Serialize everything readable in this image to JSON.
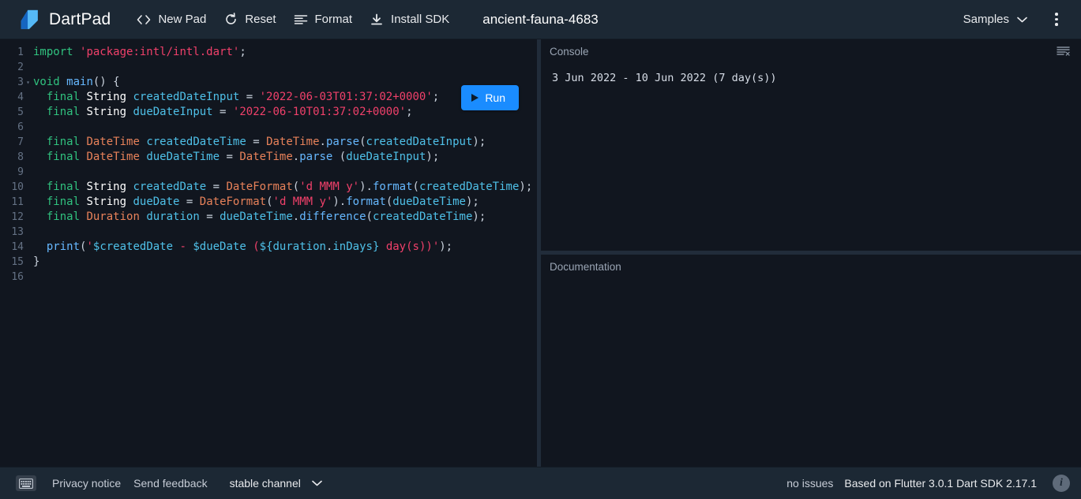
{
  "header": {
    "brand": "DartPad",
    "logo_icon": "dart-logo-icon",
    "actions": [
      {
        "label": "New Pad",
        "icon": "code-brackets-icon"
      },
      {
        "label": "Reset",
        "icon": "refresh-icon"
      },
      {
        "label": "Format",
        "icon": "format-lines-icon"
      },
      {
        "label": "Install SDK",
        "icon": "download-icon"
      }
    ],
    "document_title": "ancient-fauna-4683",
    "samples_label": "Samples",
    "samples_chevron_icon": "chevron-down-icon",
    "overflow_menu_icon": "kebab-menu-icon"
  },
  "editor": {
    "run_button": {
      "label": "Run",
      "icon": "play-icon"
    },
    "lines": [
      {
        "n": "1",
        "fold": "",
        "tokens": [
          {
            "t": "import",
            "c": "kw"
          },
          {
            "t": " ",
            "c": "punct"
          },
          {
            "t": "'package:intl/intl.dart'",
            "c": "str"
          },
          {
            "t": ";",
            "c": "punct"
          }
        ]
      },
      {
        "n": "2",
        "fold": "",
        "tokens": []
      },
      {
        "n": "3",
        "fold": "▾",
        "tokens": [
          {
            "t": "void",
            "c": "kw"
          },
          {
            "t": " ",
            "c": "punct"
          },
          {
            "t": "main",
            "c": "kw2"
          },
          {
            "t": "() {",
            "c": "punct"
          }
        ]
      },
      {
        "n": "4",
        "fold": "",
        "tokens": [
          {
            "t": "  ",
            "c": "punct"
          },
          {
            "t": "final",
            "c": "kw"
          },
          {
            "t": " ",
            "c": "punct"
          },
          {
            "t": "String",
            "c": "type"
          },
          {
            "t": " ",
            "c": "punct"
          },
          {
            "t": "createdDateInput",
            "c": "var"
          },
          {
            "t": " = ",
            "c": "punct"
          },
          {
            "t": "'2022-06-03T01:37:02+0000'",
            "c": "str"
          },
          {
            "t": ";",
            "c": "punct"
          }
        ]
      },
      {
        "n": "5",
        "fold": "",
        "tokens": [
          {
            "t": "  ",
            "c": "punct"
          },
          {
            "t": "final",
            "c": "kw"
          },
          {
            "t": " ",
            "c": "punct"
          },
          {
            "t": "String",
            "c": "type"
          },
          {
            "t": " ",
            "c": "punct"
          },
          {
            "t": "dueDateInput",
            "c": "var"
          },
          {
            "t": " = ",
            "c": "punct"
          },
          {
            "t": "'2022-06-10T01:37:02+0000'",
            "c": "str"
          },
          {
            "t": ";",
            "c": "punct"
          }
        ]
      },
      {
        "n": "6",
        "fold": "",
        "tokens": []
      },
      {
        "n": "7",
        "fold": "",
        "tokens": [
          {
            "t": "  ",
            "c": "punct"
          },
          {
            "t": "final",
            "c": "kw"
          },
          {
            "t": " ",
            "c": "punct"
          },
          {
            "t": "DateTime",
            "c": "type2"
          },
          {
            "t": " ",
            "c": "punct"
          },
          {
            "t": "createdDateTime",
            "c": "var"
          },
          {
            "t": " = ",
            "c": "punct"
          },
          {
            "t": "DateTime",
            "c": "type2"
          },
          {
            "t": ".",
            "c": "punct"
          },
          {
            "t": "parse",
            "c": "kw2"
          },
          {
            "t": "(",
            "c": "punct"
          },
          {
            "t": "createdDateInput",
            "c": "var"
          },
          {
            "t": ");",
            "c": "punct"
          }
        ]
      },
      {
        "n": "8",
        "fold": "",
        "tokens": [
          {
            "t": "  ",
            "c": "punct"
          },
          {
            "t": "final",
            "c": "kw"
          },
          {
            "t": " ",
            "c": "punct"
          },
          {
            "t": "DateTime",
            "c": "type2"
          },
          {
            "t": " ",
            "c": "punct"
          },
          {
            "t": "dueDateTime",
            "c": "var"
          },
          {
            "t": " = ",
            "c": "punct"
          },
          {
            "t": "DateTime",
            "c": "type2"
          },
          {
            "t": ".",
            "c": "punct"
          },
          {
            "t": "parse",
            "c": "kw2"
          },
          {
            "t": " (",
            "c": "punct"
          },
          {
            "t": "dueDateInput",
            "c": "var"
          },
          {
            "t": ");",
            "c": "punct"
          }
        ]
      },
      {
        "n": "9",
        "fold": "",
        "tokens": []
      },
      {
        "n": "10",
        "fold": "",
        "tokens": [
          {
            "t": "  ",
            "c": "punct"
          },
          {
            "t": "final",
            "c": "kw"
          },
          {
            "t": " ",
            "c": "punct"
          },
          {
            "t": "String",
            "c": "type"
          },
          {
            "t": " ",
            "c": "punct"
          },
          {
            "t": "createdDate",
            "c": "var"
          },
          {
            "t": " = ",
            "c": "punct"
          },
          {
            "t": "DateFormat",
            "c": "type2"
          },
          {
            "t": "(",
            "c": "punct"
          },
          {
            "t": "'d MMM y'",
            "c": "str"
          },
          {
            "t": ").",
            "c": "punct"
          },
          {
            "t": "format",
            "c": "kw2"
          },
          {
            "t": "(",
            "c": "punct"
          },
          {
            "t": "createdDateTime",
            "c": "var"
          },
          {
            "t": ");",
            "c": "punct"
          }
        ]
      },
      {
        "n": "11",
        "fold": "",
        "tokens": [
          {
            "t": "  ",
            "c": "punct"
          },
          {
            "t": "final",
            "c": "kw"
          },
          {
            "t": " ",
            "c": "punct"
          },
          {
            "t": "String",
            "c": "type"
          },
          {
            "t": " ",
            "c": "punct"
          },
          {
            "t": "dueDate",
            "c": "var"
          },
          {
            "t": " = ",
            "c": "punct"
          },
          {
            "t": "DateFormat",
            "c": "type2"
          },
          {
            "t": "(",
            "c": "punct"
          },
          {
            "t": "'d MMM y'",
            "c": "str"
          },
          {
            "t": ").",
            "c": "punct"
          },
          {
            "t": "format",
            "c": "kw2"
          },
          {
            "t": "(",
            "c": "punct"
          },
          {
            "t": "dueDateTime",
            "c": "var"
          },
          {
            "t": ");",
            "c": "punct"
          }
        ]
      },
      {
        "n": "12",
        "fold": "",
        "tokens": [
          {
            "t": "  ",
            "c": "punct"
          },
          {
            "t": "final",
            "c": "kw"
          },
          {
            "t": " ",
            "c": "punct"
          },
          {
            "t": "Duration",
            "c": "type2"
          },
          {
            "t": " ",
            "c": "punct"
          },
          {
            "t": "duration",
            "c": "var"
          },
          {
            "t": " = ",
            "c": "punct"
          },
          {
            "t": "dueDateTime",
            "c": "var"
          },
          {
            "t": ".",
            "c": "punct"
          },
          {
            "t": "difference",
            "c": "kw2"
          },
          {
            "t": "(",
            "c": "punct"
          },
          {
            "t": "createdDateTime",
            "c": "var"
          },
          {
            "t": ");",
            "c": "punct"
          }
        ]
      },
      {
        "n": "13",
        "fold": "",
        "tokens": []
      },
      {
        "n": "14",
        "fold": "",
        "tokens": [
          {
            "t": "  ",
            "c": "punct"
          },
          {
            "t": "print",
            "c": "kw2"
          },
          {
            "t": "(",
            "c": "punct"
          },
          {
            "t": "'",
            "c": "str"
          },
          {
            "t": "$createdDate",
            "c": "interp"
          },
          {
            "t": " - ",
            "c": "str"
          },
          {
            "t": "$dueDate",
            "c": "interp"
          },
          {
            "t": " (",
            "c": "str"
          },
          {
            "t": "${",
            "c": "interp"
          },
          {
            "t": "duration",
            "c": "var"
          },
          {
            "t": ".",
            "c": "punct"
          },
          {
            "t": "inDays",
            "c": "var"
          },
          {
            "t": "}",
            "c": "interp"
          },
          {
            "t": " day(s))'",
            "c": "str"
          },
          {
            "t": ");",
            "c": "punct"
          }
        ]
      },
      {
        "n": "15",
        "fold": "",
        "tokens": [
          {
            "t": "}",
            "c": "punct"
          }
        ]
      },
      {
        "n": "16",
        "fold": "",
        "tokens": []
      }
    ]
  },
  "console": {
    "title": "Console",
    "clear_icon": "clear-console-icon",
    "output": [
      "3 Jun 2022 - 10 Jun 2022 (7 day(s))"
    ]
  },
  "documentation": {
    "title": "Documentation",
    "content": ""
  },
  "footer": {
    "keyboard_icon": "keyboard-icon",
    "privacy_label": "Privacy notice",
    "feedback_label": "Send feedback",
    "channel_label": "stable channel",
    "channel_chevron_icon": "chevron-down-icon",
    "issues_label": "no issues",
    "version_label": "Based on Flutter 3.0.1 Dart SDK 2.17.1",
    "info_icon": "info-icon"
  },
  "colors": {
    "accent_blue": "#1a8cff",
    "header_bg": "#1c2834",
    "editor_bg": "#11161f",
    "keyword_green": "#30c27f",
    "string_red": "#f0406a",
    "identifier_cyan": "#4fc1e9",
    "type_orange": "#e8825a"
  }
}
